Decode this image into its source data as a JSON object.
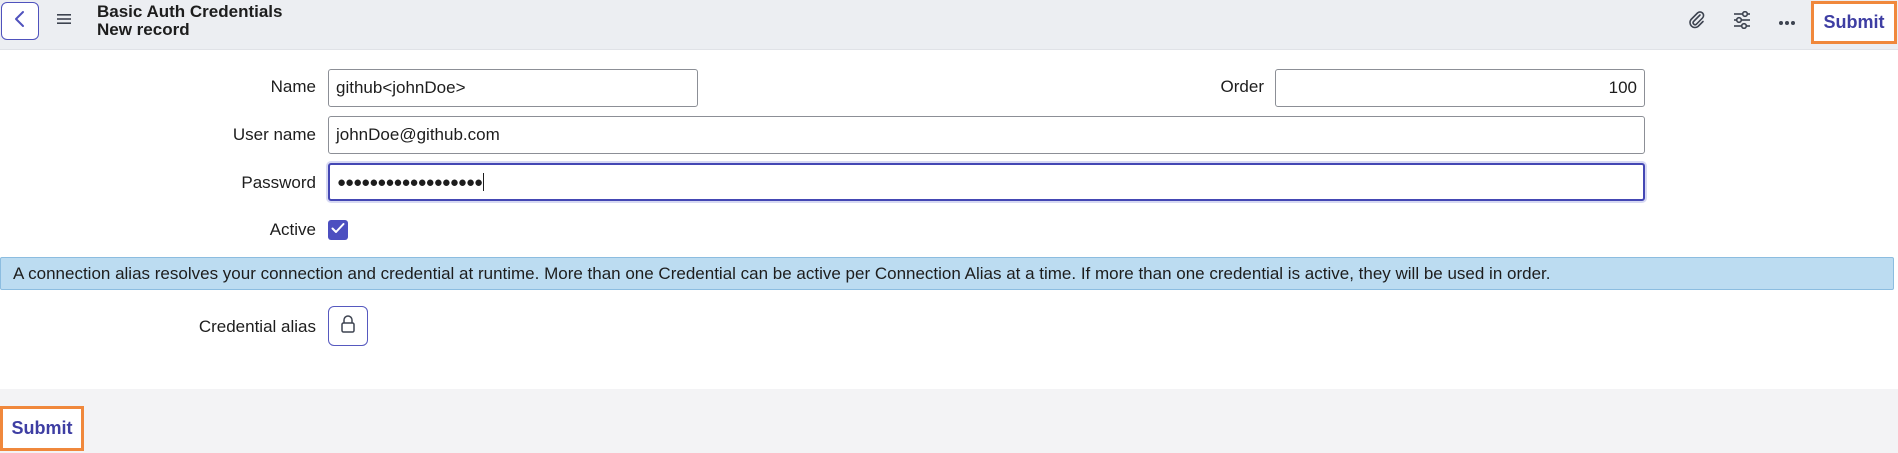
{
  "header": {
    "table_title": "Basic Auth Credentials",
    "record_title": "New record",
    "submit_label": "Submit"
  },
  "form": {
    "name_label": "Name",
    "name_value": "github<johnDoe>",
    "order_label": "Order",
    "order_value": "100",
    "username_label": "User name",
    "username_value": "johnDoe@github.com",
    "password_label": "Password",
    "password_value": "●●●●●●●●●●●●●●●●●●",
    "active_label": "Active",
    "active_checked": true,
    "info_message": "A connection alias resolves your connection and credential at runtime. More than one Credential can be active per Connection Alias at a time. If more than one credential is active, they will be used in order.",
    "credential_alias_label": "Credential alias"
  },
  "footer": {
    "submit_label": "Submit"
  },
  "colors": {
    "accent": "#4c4fc0",
    "highlight": "#f0883c",
    "info_bg": "#bcdcf1"
  }
}
